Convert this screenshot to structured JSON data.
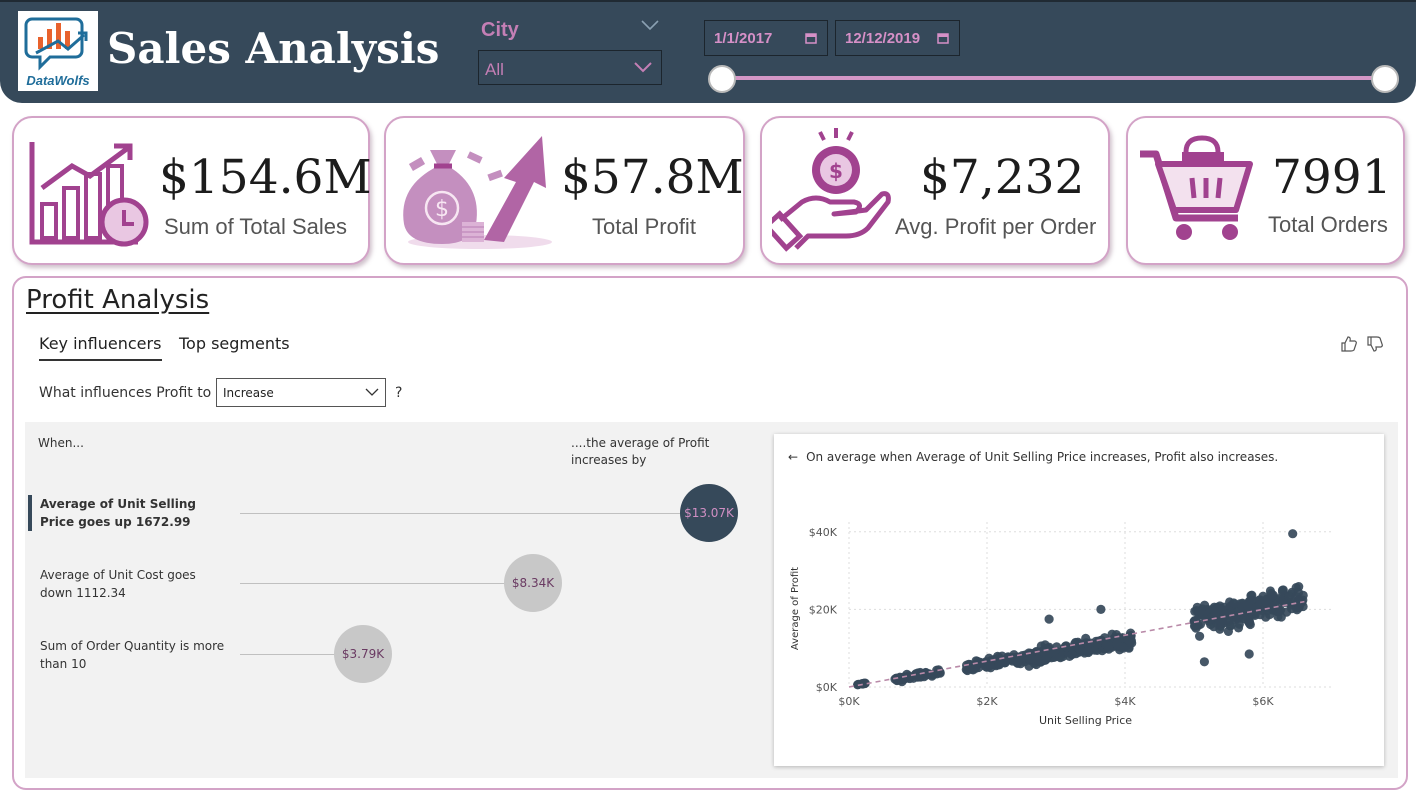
{
  "header": {
    "logo_text": "DataWolfs",
    "title": "Sales Analysis",
    "city_label": "City",
    "city_value": "All",
    "date_start": "1/1/2017",
    "date_end": "12/12/2019"
  },
  "kpis": [
    {
      "value": "$154.6M",
      "label": "Sum of Total Sales",
      "icon": "growth-chart-clock-icon"
    },
    {
      "value": "$57.8M",
      "label": "Total Profit",
      "icon": "money-bag-arrow-icon"
    },
    {
      "value": "$7,232",
      "label": "Avg. Profit per Order",
      "icon": "hand-coin-icon"
    },
    {
      "value": "7991",
      "label": "Total Orders",
      "icon": "shopping-cart-icon"
    }
  ],
  "profit_analysis": {
    "title": "Profit Analysis",
    "tabs": [
      "Key influencers",
      "Top segments"
    ],
    "active_tab": "Key influencers",
    "question_prefix": "What influences Profit to",
    "question_value": "Increase",
    "question_suffix": "?",
    "col_when": "When...",
    "col_avg": "....the average of Profit increases by",
    "influencers": [
      {
        "text": "Average of Unit Selling Price goes up 1672.99",
        "value_label": "$13.07K",
        "value": 13.07,
        "selected": true
      },
      {
        "text": "Average of Unit Cost goes down 1112.34",
        "value_label": "$8.34K",
        "value": 8.34,
        "selected": false
      },
      {
        "text": "Sum of Order Quantity is more than 10",
        "value_label": "$3.79K",
        "value": 3.79,
        "selected": false
      }
    ],
    "detail_text": "On average when Average of Unit Selling Price increases, Profit also increases."
  },
  "colors": {
    "header_bg": "#36495a",
    "accent_pink": "#c47fb5",
    "icon_purple": "#a1428f",
    "bubble_dark": "#36495a",
    "bubble_light": "#c8c8c8",
    "point": "#36495a"
  },
  "chart_data": {
    "type": "scatter",
    "xlabel": "Unit Selling Price",
    "ylabel": "Average of Profit",
    "xlim": [
      0,
      7000
    ],
    "ylim": [
      0,
      42000
    ],
    "x_ticks": [
      0,
      2000,
      4000,
      6000
    ],
    "x_tick_labels": [
      "$0K",
      "$2K",
      "$4K",
      "$6K"
    ],
    "y_ticks": [
      0,
      20000,
      40000
    ],
    "y_tick_labels": [
      "$0K",
      "$20K",
      "$40K"
    ],
    "grid": true,
    "trendline": {
      "x": [
        0,
        6600
      ],
      "y": [
        0,
        22000
      ]
    },
    "clusters": [
      {
        "x_min": 100,
        "x_max": 300,
        "y_center": 900,
        "y_spread": 300,
        "count": 10
      },
      {
        "x_min": 650,
        "x_max": 1350,
        "y_center": 3000,
        "y_spread": 1000,
        "count": 55
      },
      {
        "x_min": 1700,
        "x_max": 2900,
        "y_center": 7000,
        "y_spread": 1800,
        "count": 120
      },
      {
        "x_min": 2600,
        "x_max": 4100,
        "y_center": 10000,
        "y_spread": 3000,
        "count": 200
      },
      {
        "x_min": 5000,
        "x_max": 6600,
        "y_center": 20000,
        "y_spread": 5500,
        "count": 220
      }
    ],
    "outliers": [
      {
        "x": 6430,
        "y": 39500
      },
      {
        "x": 3650,
        "y": 20000
      },
      {
        "x": 2900,
        "y": 17500
      },
      {
        "x": 5150,
        "y": 6500
      },
      {
        "x": 5800,
        "y": 8500
      }
    ]
  }
}
